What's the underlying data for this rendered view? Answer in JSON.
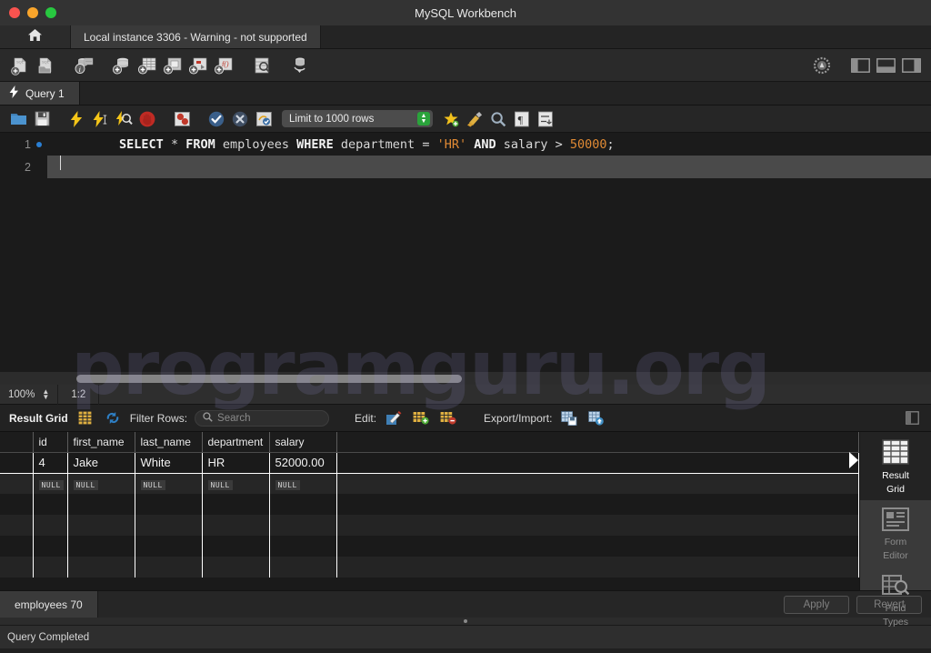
{
  "window": {
    "title": "MySQL Workbench",
    "traffic_lights": [
      "close",
      "minimize",
      "maximize"
    ],
    "colors": {
      "red": "#f9534f",
      "amber": "#f9a52b",
      "green": "#28c840"
    }
  },
  "connection_bar": {
    "home_icon": "home-icon",
    "tab_label": "Local instance 3306 - Warning - not supported"
  },
  "main_toolbar": {
    "left_icons": [
      "new-sql-file-icon",
      "open-sql-file-icon",
      "server-status-icon",
      "new-schema-icon",
      "new-table-icon",
      "new-view-icon",
      "new-procedure-icon",
      "new-function-icon",
      "inspect-table-icon",
      "search-data-icon"
    ],
    "right_icons": [
      "settings-gear-icon",
      "toggle-sidebar-icon",
      "toggle-output-icon",
      "toggle-secondary-sidebar-icon"
    ]
  },
  "query_tab": {
    "icon": "lightning-bolt-icon",
    "label": "Query 1"
  },
  "editor_toolbar": {
    "icons": [
      "open-file-icon",
      "save-file-icon",
      "execute-icon",
      "execute-current-icon",
      "explain-icon",
      "stop-icon",
      "toggle-breakpoint-icon",
      "commit-icon",
      "rollback-icon",
      "autocommit-icon"
    ],
    "limit_label": "Limit to 1000 rows",
    "right_icons": [
      "beautify-icon",
      "clear-context-icon",
      "find-icon",
      "invisible-chars-icon",
      "wrap-lines-icon"
    ]
  },
  "editor": {
    "lines": [
      {
        "number": "1",
        "has_breakpoint_dot": true,
        "tokens": [
          {
            "t": "SELECT",
            "c": "kw"
          },
          {
            "t": " ",
            "c": "id"
          },
          {
            "t": "*",
            "c": "op"
          },
          {
            "t": " ",
            "c": "id"
          },
          {
            "t": "FROM",
            "c": "kw"
          },
          {
            "t": " ",
            "c": "id"
          },
          {
            "t": "employees",
            "c": "id"
          },
          {
            "t": " ",
            "c": "id"
          },
          {
            "t": "WHERE",
            "c": "kw"
          },
          {
            "t": " ",
            "c": "id"
          },
          {
            "t": "department",
            "c": "id"
          },
          {
            "t": " ",
            "c": "id"
          },
          {
            "t": "=",
            "c": "op"
          },
          {
            "t": " ",
            "c": "id"
          },
          {
            "t": "'HR'",
            "c": "str"
          },
          {
            "t": " ",
            "c": "id"
          },
          {
            "t": "AND",
            "c": "kw"
          },
          {
            "t": " ",
            "c": "id"
          },
          {
            "t": "salary",
            "c": "id"
          },
          {
            "t": " ",
            "c": "id"
          },
          {
            "t": ">",
            "c": "op"
          },
          {
            "t": " ",
            "c": "id"
          },
          {
            "t": "50000",
            "c": "num"
          },
          {
            "t": ";",
            "c": "op"
          }
        ]
      },
      {
        "number": "2",
        "has_breakpoint_dot": false,
        "tokens": []
      }
    ],
    "full_text": "SELECT * FROM employees WHERE department = 'HR' AND salary > 50000;"
  },
  "editor_status": {
    "zoom": "100%",
    "cursor_position": "1:2"
  },
  "result_toolbar": {
    "title": "Result Grid",
    "grid_icon": "result-grid-icon",
    "refresh_icon": "refresh-icon",
    "filter_label": "Filter Rows:",
    "search_placeholder": "Search",
    "search_value": "",
    "search_icon": "search-icon",
    "edit_label": "Edit:",
    "edit_icons": [
      "edit-row-icon",
      "add-row-icon",
      "delete-row-icon"
    ],
    "export_label": "Export/Import:",
    "export_icons": [
      "export-recordset-icon",
      "import-recordset-icon"
    ],
    "panel_toggle_icon": "toggle-panel-icon"
  },
  "result_grid": {
    "columns": [
      "id",
      "first_name",
      "last_name",
      "department",
      "salary"
    ],
    "rows": [
      {
        "type": "data",
        "cells": [
          "4",
          "Jake",
          "White",
          "HR",
          "52000.00"
        ]
      },
      {
        "type": "null",
        "cells": [
          "NULL",
          "NULL",
          "NULL",
          "NULL",
          "NULL"
        ]
      },
      {
        "type": "blank",
        "cells": [
          "",
          "",
          "",
          "",
          ""
        ]
      },
      {
        "type": "blank-alt",
        "cells": [
          "",
          "",
          "",
          "",
          ""
        ]
      },
      {
        "type": "blank",
        "cells": [
          "",
          "",
          "",
          "",
          ""
        ]
      },
      {
        "type": "blank-alt",
        "cells": [
          "",
          "",
          "",
          "",
          ""
        ]
      }
    ]
  },
  "side_panel": {
    "items": [
      {
        "label_line1": "Result",
        "label_line2": "Grid",
        "icon": "result-grid-icon",
        "active": true
      },
      {
        "label_line1": "Form",
        "label_line2": "Editor",
        "icon": "form-editor-icon",
        "active": false
      },
      {
        "label_line1": "Field",
        "label_line2": "Types",
        "icon": "field-types-icon",
        "active": false
      }
    ]
  },
  "bottom_bar": {
    "result_tab": "employees 70",
    "apply_label": "Apply",
    "revert_label": "Revert"
  },
  "status_bar": {
    "message": "Query Completed"
  },
  "watermark": {
    "text": "programguru.org"
  }
}
